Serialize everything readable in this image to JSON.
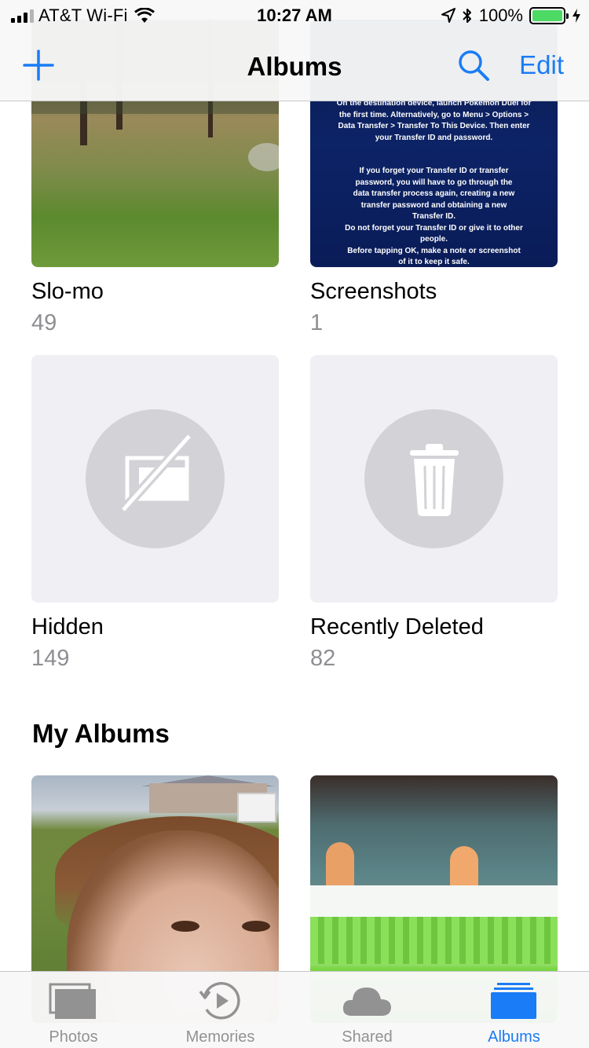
{
  "status_bar": {
    "carrier": "AT&T Wi-Fi",
    "time": "10:27 AM",
    "battery": "100%"
  },
  "nav": {
    "title": "Albums",
    "edit_label": "Edit",
    "accent_color": "#1a7cf6"
  },
  "albums": [
    {
      "name": "Slo-mo",
      "count": "49"
    },
    {
      "name": "Screenshots",
      "count": "1"
    },
    {
      "name": "Hidden",
      "count": "149"
    },
    {
      "name": "Recently Deleted",
      "count": "82"
    }
  ],
  "screenshot_thumb_lines": [
    "On the destination device, launch Pokémon Duel for",
    "the first time. Alternatively, go to Menu > Options >",
    "Data Transfer > Transfer To This Device. Then enter",
    "your Transfer ID and password.",
    "",
    "If you forget your Transfer ID or transfer",
    "password, you will have to go through the",
    "data transfer process again, creating a new",
    "transfer password and obtaining a new",
    "Transfer ID.",
    "Do not forget your Transfer ID or give it to other",
    "people.",
    "Before tapping OK, make a note or screenshot",
    "of it to keep it safe."
  ],
  "my_albums": {
    "title": "My Albums"
  },
  "tabs": [
    {
      "label": "Photos",
      "icon": "photos-icon",
      "active": false
    },
    {
      "label": "Memories",
      "icon": "memories-icon",
      "active": false
    },
    {
      "label": "Shared",
      "icon": "cloud-icon",
      "active": false
    },
    {
      "label": "Albums",
      "icon": "albums-icon",
      "active": true
    }
  ]
}
